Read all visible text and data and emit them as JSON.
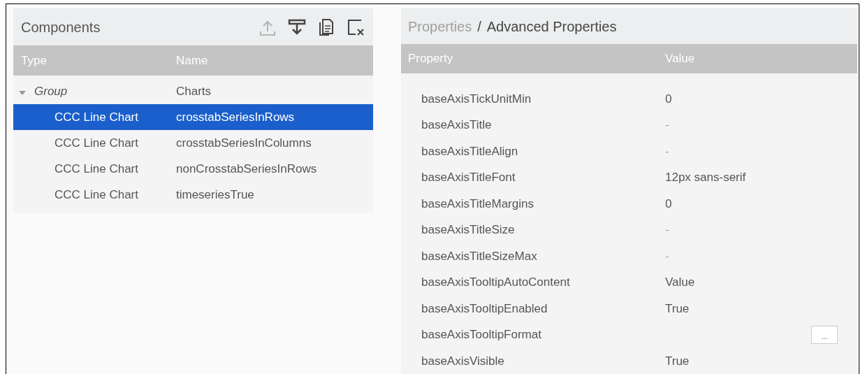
{
  "components": {
    "title": "Components",
    "toolbar": [
      {
        "kind": "upload",
        "disabled": true
      },
      {
        "kind": "filter",
        "disabled": false
      },
      {
        "kind": "copy",
        "disabled": false
      },
      {
        "kind": "delete",
        "disabled": false
      }
    ],
    "columns": [
      "Type",
      "Name"
    ],
    "tree": [
      {
        "type": "Group",
        "name": "Charts",
        "expanded": true,
        "selected": false,
        "children": [
          {
            "type": "CCC Line Chart",
            "name": "crosstabSeriesInRows",
            "selected": true
          },
          {
            "type": "CCC Line Chart",
            "name": "crosstabSeriesInColumns",
            "selected": false
          },
          {
            "type": "CCC Line Chart",
            "name": "nonCrosstabSeriesInRows",
            "selected": false
          },
          {
            "type": "CCC Line Chart",
            "name": "timeseriesTrue",
            "selected": false
          }
        ]
      }
    ]
  },
  "properties": {
    "breadcrumb": [
      {
        "label": "Properties",
        "current": false
      },
      {
        "label": "Advanced Properties",
        "current": true
      }
    ],
    "separator": "/",
    "columns": [
      "Property",
      "Value"
    ],
    "rows": [
      {
        "name": "baseAxisTickUnitMin",
        "value": "0"
      },
      {
        "name": "baseAxisTitle",
        "value": "-"
      },
      {
        "name": "baseAxisTitleAlign",
        "value": "-"
      },
      {
        "name": "baseAxisTitleFont",
        "value": "12px sans-serif"
      },
      {
        "name": "baseAxisTitleMargins",
        "value": "0"
      },
      {
        "name": "baseAxisTitleSize",
        "value": "-"
      },
      {
        "name": "baseAxisTitleSizeMax",
        "value": "-"
      },
      {
        "name": "baseAxisTooltipAutoContent",
        "value": "Value"
      },
      {
        "name": "baseAxisTooltipEnabled",
        "value": "True"
      },
      {
        "name": "baseAxisTooltipFormat",
        "button": "..."
      },
      {
        "name": "baseAxisVisible",
        "value": "True"
      }
    ]
  }
}
